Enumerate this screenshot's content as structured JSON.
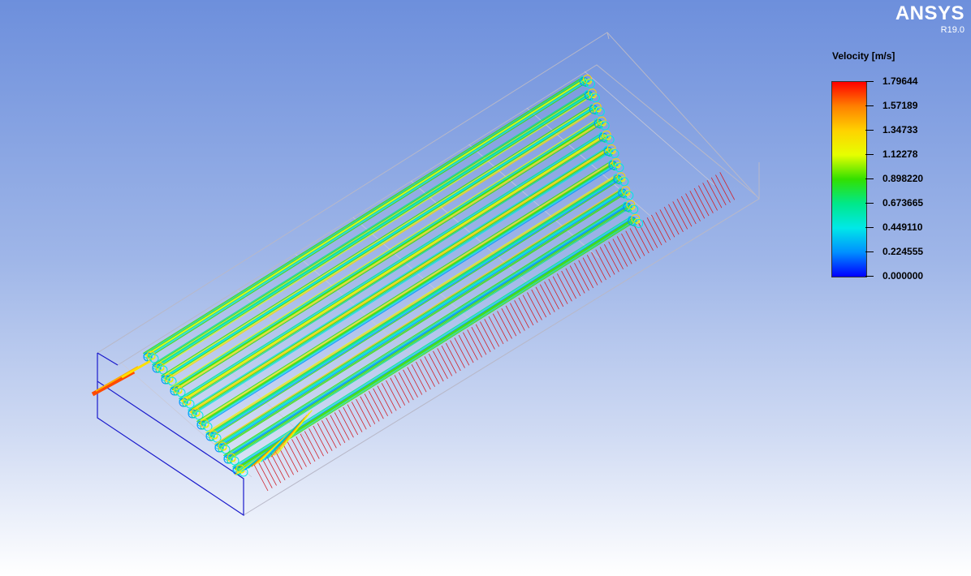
{
  "brand": {
    "name": "ANSYS",
    "version": "R19.0"
  },
  "legend": {
    "title": "Velocity [m/s]",
    "ticks": [
      "1.79644",
      "1.57189",
      "1.34733",
      "1.12278",
      "0.898220",
      "0.673665",
      "0.449110",
      "0.224555",
      "0.000000"
    ],
    "colors": [
      "#ff0000",
      "#ff8000",
      "#ffd200",
      "#e6ff00",
      "#32e000",
      "#00e88a",
      "#00e8e8",
      "#0090ff",
      "#0000ff"
    ]
  }
}
